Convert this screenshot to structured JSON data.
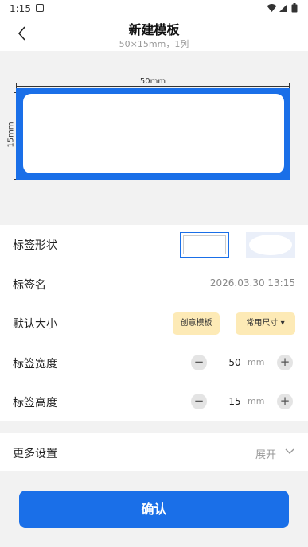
{
  "status_bar": {
    "time": "1:15"
  },
  "header": {
    "title": "新建模板",
    "subtitle": "50×15mm，1列"
  },
  "preview": {
    "width_label": "50mm",
    "height_label": "15mm",
    "label_color": "#1a6fe8"
  },
  "form": {
    "shape_label": "标签形状",
    "name_label": "标签名",
    "name_value": "2026.03.30 13:15",
    "size_label": "默认大小",
    "create_template_chip": "创意模板",
    "common_size_chip": "常用尺寸 ▾",
    "width_label": "标签宽度",
    "width_value": "50",
    "width_unit": "mm",
    "height_label": "标签高度",
    "height_value": "15",
    "height_unit": "mm"
  },
  "more_settings": {
    "label": "更多设置",
    "expand": "展开"
  },
  "confirm_label": "确认",
  "colors": {
    "accent": "#1a6fe8",
    "chip": "#fdeab6"
  }
}
